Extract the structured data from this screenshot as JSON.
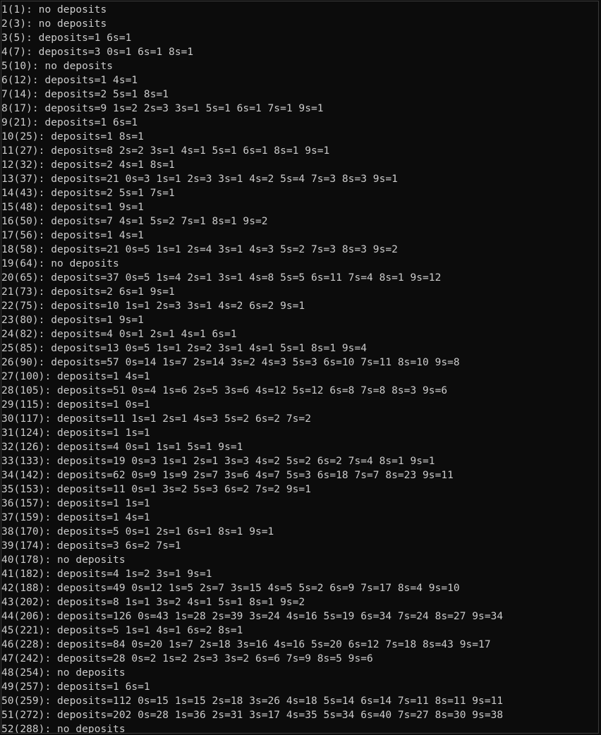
{
  "console": {
    "background": "#0c0c0c",
    "foreground": "#cccccc",
    "lines": [
      "1(1): no deposits",
      "2(3): no deposits",
      "3(5): deposits=1 6s=1",
      "4(7): deposits=3 0s=1 6s=1 8s=1",
      "5(10): no deposits",
      "6(12): deposits=1 4s=1",
      "7(14): deposits=2 5s=1 8s=1",
      "8(17): deposits=9 1s=2 2s=3 3s=1 5s=1 6s=1 7s=1 9s=1",
      "9(21): deposits=1 6s=1",
      "10(25): deposits=1 8s=1",
      "11(27): deposits=8 2s=2 3s=1 4s=1 5s=1 6s=1 8s=1 9s=1",
      "12(32): deposits=2 4s=1 8s=1",
      "13(37): deposits=21 0s=3 1s=1 2s=3 3s=1 4s=2 5s=4 7s=3 8s=3 9s=1",
      "14(43): deposits=2 5s=1 7s=1",
      "15(48): deposits=1 9s=1",
      "16(50): deposits=7 4s=1 5s=2 7s=1 8s=1 9s=2",
      "17(56): deposits=1 4s=1",
      "18(58): deposits=21 0s=5 1s=1 2s=4 3s=1 4s=3 5s=2 7s=3 8s=3 9s=2",
      "19(64): no deposits",
      "20(65): deposits=37 0s=5 1s=4 2s=1 3s=1 4s=8 5s=5 6s=11 7s=4 8s=1 9s=12",
      "21(73): deposits=2 6s=1 9s=1",
      "22(75): deposits=10 1s=1 2s=3 3s=1 4s=2 6s=2 9s=1",
      "23(80): deposits=1 9s=1",
      "24(82): deposits=4 0s=1 2s=1 4s=1 6s=1",
      "25(85): deposits=13 0s=5 1s=1 2s=2 3s=1 4s=1 5s=1 8s=1 9s=4",
      "26(90): deposits=57 0s=14 1s=7 2s=14 3s=2 4s=3 5s=3 6s=10 7s=11 8s=10 9s=8",
      "27(100): deposits=1 4s=1",
      "28(105): deposits=51 0s=4 1s=6 2s=5 3s=6 4s=12 5s=12 6s=8 7s=8 8s=3 9s=6",
      "29(115): deposits=1 0s=1",
      "30(117): deposits=11 1s=1 2s=1 4s=3 5s=2 6s=2 7s=2",
      "31(124): deposits=1 1s=1",
      "32(126): deposits=4 0s=1 1s=1 5s=1 9s=1",
      "33(133): deposits=19 0s=3 1s=1 2s=1 3s=3 4s=2 5s=2 6s=2 7s=4 8s=1 9s=1",
      "34(142): deposits=62 0s=9 1s=9 2s=7 3s=6 4s=7 5s=3 6s=18 7s=7 8s=23 9s=11",
      "35(153): deposits=11 0s=1 3s=2 5s=3 6s=2 7s=2 9s=1",
      "36(157): deposits=1 1s=1",
      "37(159): deposits=1 4s=1",
      "38(170): deposits=5 0s=1 2s=1 6s=1 8s=1 9s=1",
      "39(174): deposits=3 6s=2 7s=1",
      "40(178): no deposits",
      "41(182): deposits=4 1s=2 3s=1 9s=1",
      "42(188): deposits=49 0s=12 1s=5 2s=7 3s=15 4s=5 5s=2 6s=9 7s=17 8s=4 9s=10",
      "43(202): deposits=8 1s=1 3s=2 4s=1 5s=1 8s=1 9s=2",
      "44(206): deposits=126 0s=43 1s=28 2s=39 3s=24 4s=16 5s=19 6s=34 7s=24 8s=27 9s=34",
      "45(221): deposits=5 1s=1 4s=1 6s=2 8s=1",
      "46(228): deposits=84 0s=20 1s=7 2s=18 3s=16 4s=16 5s=20 6s=12 7s=18 8s=43 9s=17",
      "47(242): deposits=28 0s=2 1s=2 2s=3 3s=2 6s=6 7s=9 8s=5 9s=6",
      "48(254): no deposits",
      "49(257): deposits=1 6s=1",
      "50(259): deposits=112 0s=15 1s=15 2s=18 3s=26 4s=18 5s=14 6s=14 7s=11 8s=11 9s=11",
      "51(272): deposits=202 0s=28 1s=36 2s=31 3s=17 4s=35 5s=34 6s=40 7s=27 8s=30 9s=38",
      "52(288): no deposits"
    ]
  }
}
